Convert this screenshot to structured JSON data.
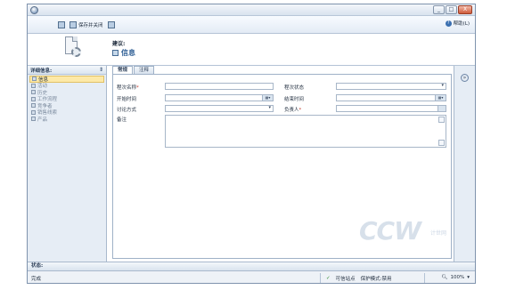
{
  "window": {
    "controls": [
      "_",
      "□",
      "X"
    ]
  },
  "toolbar": {
    "save_close_label": "保存并关闭",
    "help_label": "帮助(L)"
  },
  "header": {
    "entity_type": "建议:",
    "entity_title": "信息"
  },
  "left_nav": {
    "header": "详细信息:",
    "collapse_symbol": "⇕",
    "items": [
      {
        "label": "信息",
        "active": true
      },
      {
        "label": "活动",
        "active": false
      },
      {
        "label": "历史",
        "active": false
      },
      {
        "label": "工作流程",
        "active": false
      },
      {
        "label": "竞争者",
        "active": false
      },
      {
        "label": "销售线索",
        "active": false
      },
      {
        "label": "产品",
        "active": false
      }
    ]
  },
  "tabs": [
    {
      "label": "常规",
      "active": true
    },
    {
      "label": "注释",
      "active": false
    }
  ],
  "form": {
    "campaign_name_label": "程次名称",
    "required_mark": "*",
    "status_label": "程次状态",
    "start_time_label": "开始时间",
    "end_time_label": "结束时间",
    "budget_label": "讨论方式",
    "owner_label": "负责人",
    "notes_label": "备注"
  },
  "footer": {
    "label": "状态:"
  },
  "statusbar": {
    "left": "完成",
    "trusted_sites": "可信站点",
    "protected_mode": "保护模式:禁用",
    "zoom": "100%"
  },
  "watermark": {
    "text": "CCW",
    "sub": "计世网"
  },
  "colors": {
    "accent": "#2f5f95",
    "active_nav": "#fde9a8",
    "window_border": "#7f93ad"
  }
}
